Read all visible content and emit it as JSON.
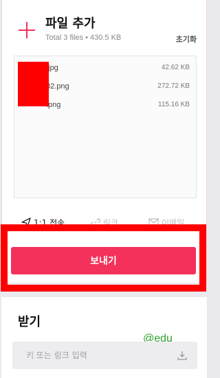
{
  "add_section": {
    "title": "파일 추가",
    "summary": "Total 3 files • 430.5 KB",
    "reset_label": "초기화"
  },
  "files": [
    {
      "name": ".jpg",
      "size": "42.62 KB"
    },
    {
      "name": "02.png",
      "size": "272.72 KB"
    },
    {
      "name": ".png",
      "size": "115.16 KB"
    }
  ],
  "tabs": [
    {
      "label": "1:1 전송",
      "icon": "paper-plane-icon",
      "active": true
    },
    {
      "label": "링크",
      "icon": "link-icon",
      "active": false
    },
    {
      "label": "이메일",
      "icon": "mail-icon",
      "active": false
    }
  ],
  "send_button_label": "보내기",
  "receive_section": {
    "title": "받기",
    "input_placeholder": "키 또는 링크 입력"
  },
  "watermark_text": "@edu",
  "colors": {
    "accent": "#f4315a",
    "highlight": "#ff0000",
    "watermark": "#2f9e2f"
  }
}
